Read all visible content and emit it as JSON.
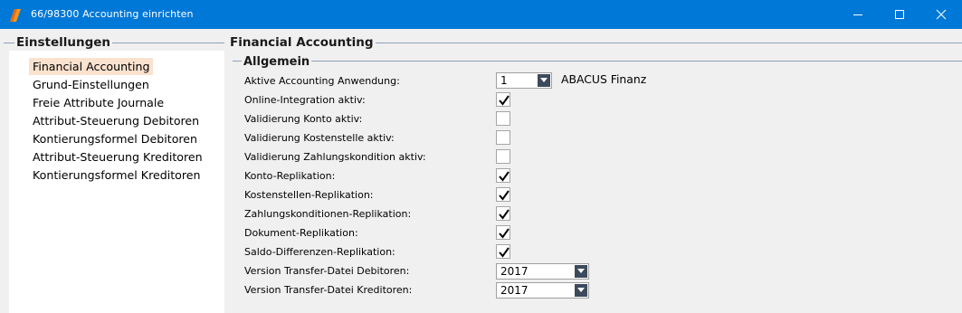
{
  "window": {
    "title": "66/98300 Accounting einrichten",
    "icon": "app-tag-icon",
    "accent": "#0078d7"
  },
  "left": {
    "heading": "Einstellungen",
    "items": [
      {
        "label": "Financial Accounting",
        "selected": true
      },
      {
        "label": "Grund-Einstellungen"
      },
      {
        "label": "Freie Attribute Journale"
      },
      {
        "label": "Attribut-Steuerung Debitoren"
      },
      {
        "label": "Kontierungsformel Debitoren"
      },
      {
        "label": "Attribut-Steuerung Kreditoren"
      },
      {
        "label": "Kontierungsformel Kreditoren"
      }
    ],
    "selected_color": "#fbe2cf"
  },
  "main": {
    "heading": "Financial Accounting",
    "group": "Allgemein",
    "app_select": {
      "label": "Aktive Accounting Anwendung:",
      "value": "1",
      "description": "ABACUS Finanz"
    },
    "checks": [
      {
        "label": "Online-Integration aktiv:",
        "checked": true
      },
      {
        "label": "Validierung Konto aktiv:",
        "checked": false
      },
      {
        "label": "Validierung Kostenstelle aktiv:",
        "checked": false
      },
      {
        "label": "Validierung Zahlungskondition aktiv:",
        "checked": false
      },
      {
        "label": "Konto-Replikation:",
        "checked": true
      },
      {
        "label": "Kostenstellen-Replikation:",
        "checked": true
      },
      {
        "label": "Zahlungskonditionen-Replikation:",
        "checked": true
      },
      {
        "label": "Dokument-Replikation:",
        "checked": true
      },
      {
        "label": "Saldo-Differenzen-Replikation:",
        "checked": true
      }
    ],
    "version_debitoren": {
      "label": "Version Transfer-Datei Debitoren:",
      "value": "2017"
    },
    "version_kreditoren": {
      "label": "Version Transfer-Datei Kreditoren:",
      "value": "2017"
    }
  }
}
